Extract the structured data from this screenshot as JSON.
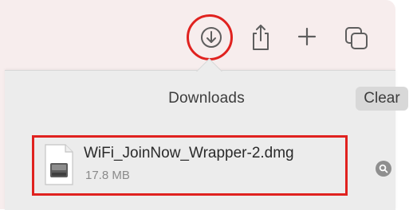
{
  "toolbar": {
    "download_icon": "arrow-down-circle-icon",
    "share_icon": "share-icon",
    "add_icon": "plus-icon",
    "tabs_icon": "tab-overview-icon"
  },
  "downloads": {
    "title": "Downloads",
    "clear_label": "Clear",
    "items": [
      {
        "name": "WiFi_JoinNow_Wrapper-2.dmg",
        "size": "17.8 MB",
        "icon": "disk-image-file-icon",
        "action_icon": "magnifier-icon"
      }
    ]
  },
  "colors": {
    "highlight": "#e0221f",
    "window_bg": "#f7eded",
    "popover_bg": "#ececec"
  }
}
